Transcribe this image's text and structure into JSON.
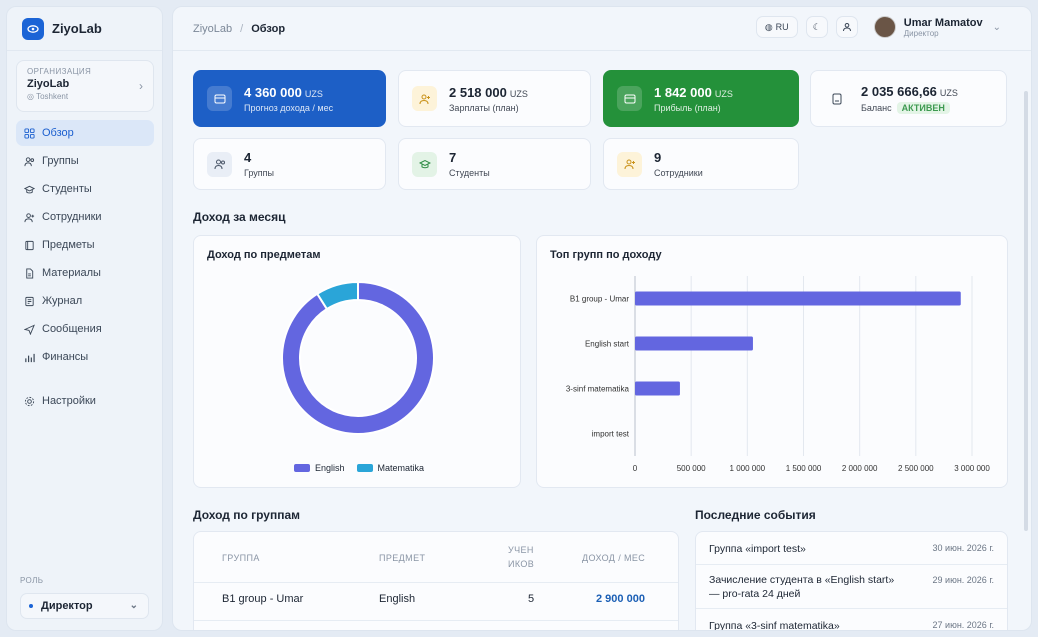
{
  "app": {
    "logo": "ZiyoLab"
  },
  "org": {
    "caption": "ОРГАНИЗАЦИЯ",
    "name": "ZiyoLab",
    "sub": "Toshkent"
  },
  "nav": [
    "Обзор",
    "Группы",
    "Студенты",
    "Сотрудники",
    "Предметы",
    "Материалы",
    "Журнал",
    "Сообщения",
    "Финансы"
  ],
  "settings": "Настройки",
  "role": {
    "caption": "РОЛЬ",
    "value": "Директор"
  },
  "breadcrumb": {
    "root": "ZiyoLab",
    "current": "Обзор"
  },
  "topbar": {
    "lang": "RU",
    "user_name": "Umar Mamatov",
    "user_role": "Директор"
  },
  "cards": [
    {
      "value": "4 360 000",
      "cur": "UZS",
      "label": "Прогноз дохода / мес"
    },
    {
      "value": "2 518 000",
      "cur": "UZS",
      "label": "Зарплаты (план)"
    },
    {
      "value": "1 842 000",
      "cur": "UZS",
      "label": "Прибыль (план)"
    },
    {
      "value": "2 035 666,66",
      "cur": "UZS",
      "label": "Баланс",
      "badge": "АКТИВЕН"
    },
    {
      "value": "4",
      "label": "Группы"
    },
    {
      "value": "7",
      "label": "Студенты"
    },
    {
      "value": "9",
      "label": "Сотрудники"
    }
  ],
  "section_month": "Доход за месяц",
  "donut": {
    "title": "Доход по предметам"
  },
  "bars": {
    "title": "Топ групп по доходу"
  },
  "colors": {
    "accent": "#6366e0",
    "secondary": "#2aa5d8",
    "blue_card": "#1d5fc6",
    "green_card": "#24913a"
  },
  "chart_data": [
    {
      "type": "pie",
      "title": "Доход по предметам",
      "categories": [
        "English",
        "Matematika"
      ],
      "values": [
        91,
        9
      ]
    },
    {
      "type": "bar",
      "orientation": "horizontal",
      "title": "Топ групп по доходу",
      "categories": [
        "B1 group - Umar",
        "English start",
        "3-sinf matematika",
        "import test"
      ],
      "values": [
        2900000,
        1050000,
        400000,
        0
      ],
      "xlim": [
        0,
        3000000
      ],
      "xticks": [
        "0",
        "500 000",
        "1 000 000",
        "1 500 000",
        "2 000 000",
        "2 500 000",
        "3 000 000"
      ],
      "grid": true
    }
  ],
  "groups_section": {
    "title": "Доход по группам",
    "headers": [
      "ГРУППА",
      "ПРЕДМЕТ",
      "УЧЕН",
      "ИКОВ",
      "ДОХОД / МЕС"
    ],
    "rows": [
      {
        "group": "B1 group - Umar",
        "subject": "English",
        "students": "5",
        "income": "2 900 000"
      }
    ]
  },
  "events": {
    "title": "Последние события",
    "items": [
      {
        "text": "Группа «import test»",
        "date": "30 июн. 2026 г."
      },
      {
        "text": "Зачисление студента в «English start»",
        "text2": "— pro-rata 24 дней",
        "date": "29 июн. 2026 г."
      },
      {
        "text": "Группа «3-sinf matematika»",
        "date": "27 июн. 2026 г."
      }
    ]
  }
}
